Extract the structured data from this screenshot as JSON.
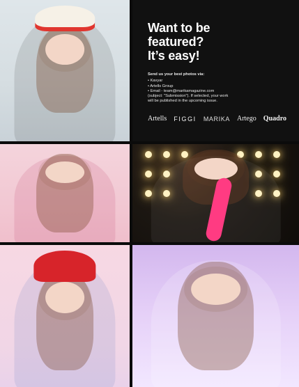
{
  "featured": {
    "headline": "Want to be\nfeatured?\nIt’s easy!",
    "send_label": "Send us your best photos via:",
    "bullets": [
      "• Kavyar",
      "• Artells Group",
      "• Email - team@marikamagazine.com"
    ],
    "subject_line": "(subject: \"Submission\"). If selected, your work",
    "publish_line": "will be published in the upcoming issue.",
    "brands": [
      "Artells",
      "FIGGI",
      "MARIKA",
      "Artego",
      "Quadro"
    ]
  },
  "colors": {
    "panel_bg": "#111111",
    "text": "#ffffff",
    "page_bg": "#0b0b0b"
  }
}
